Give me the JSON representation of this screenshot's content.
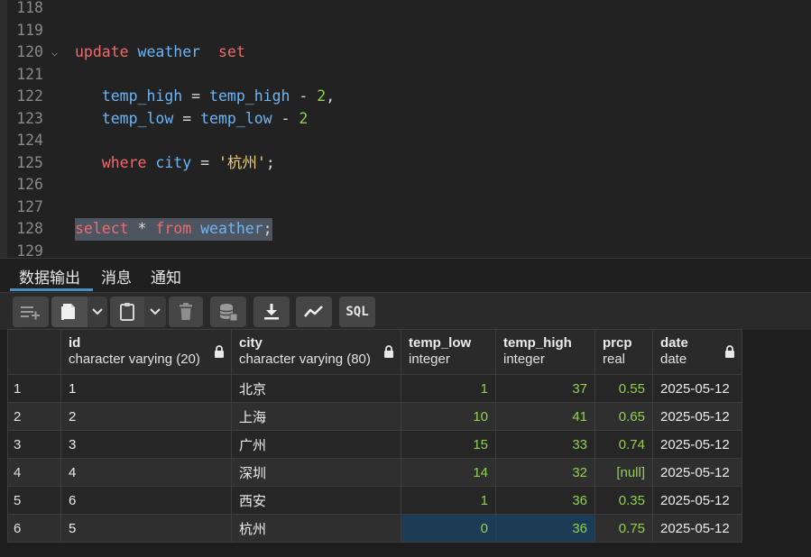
{
  "editor": {
    "lines": [
      {
        "num": "118",
        "tokens": []
      },
      {
        "num": "119",
        "tokens": []
      },
      {
        "num": "120",
        "fold": true,
        "tokens": [
          {
            "t": "update",
            "c": "kw"
          },
          {
            "t": " ",
            "c": "pl"
          },
          {
            "t": "weather",
            "c": "id"
          },
          {
            "t": "  ",
            "c": "pl"
          },
          {
            "t": "set",
            "c": "kw"
          }
        ]
      },
      {
        "num": "121",
        "tokens": []
      },
      {
        "num": "122",
        "tokens": [
          {
            "t": "   ",
            "c": "pl"
          },
          {
            "t": "temp_high",
            "c": "id"
          },
          {
            "t": " = ",
            "c": "op"
          },
          {
            "t": "temp_high",
            "c": "id"
          },
          {
            "t": " - ",
            "c": "op"
          },
          {
            "t": "2",
            "c": "num"
          },
          {
            "t": ",",
            "c": "pl"
          }
        ]
      },
      {
        "num": "123",
        "tokens": [
          {
            "t": "   ",
            "c": "pl"
          },
          {
            "t": "temp_low",
            "c": "id"
          },
          {
            "t": " = ",
            "c": "op"
          },
          {
            "t": "temp_low",
            "c": "id"
          },
          {
            "t": " - ",
            "c": "op"
          },
          {
            "t": "2",
            "c": "num"
          }
        ]
      },
      {
        "num": "124",
        "tokens": []
      },
      {
        "num": "125",
        "tokens": [
          {
            "t": "   ",
            "c": "pl"
          },
          {
            "t": "where",
            "c": "kw"
          },
          {
            "t": " ",
            "c": "pl"
          },
          {
            "t": "city",
            "c": "id"
          },
          {
            "t": " = ",
            "c": "op"
          },
          {
            "t": "'杭州'",
            "c": "str"
          },
          {
            "t": ";",
            "c": "pl"
          }
        ]
      },
      {
        "num": "126",
        "tokens": []
      },
      {
        "num": "127",
        "tokens": []
      },
      {
        "num": "128",
        "selected": true,
        "tokens": [
          {
            "t": "select",
            "c": "kw"
          },
          {
            "t": " * ",
            "c": "op"
          },
          {
            "t": "from",
            "c": "kw"
          },
          {
            "t": " ",
            "c": "pl"
          },
          {
            "t": "weather",
            "c": "id"
          },
          {
            "t": ";",
            "c": "pl"
          }
        ]
      },
      {
        "num": "129",
        "tokens": []
      }
    ]
  },
  "tabs": [
    "数据输出",
    "消息",
    "通知"
  ],
  "toolbar": {
    "icons": [
      "add-row-icon",
      "copy-icon",
      "chevron-down-icon",
      "paste-icon",
      "chevron-down-icon",
      "delete-icon",
      "save-data-icon",
      "download-icon",
      "graph-visualiser-icon",
      "sql-icon"
    ],
    "sql_label": "SQL"
  },
  "grid": {
    "columns": [
      {
        "name": "id",
        "type": "character varying (20)"
      },
      {
        "name": "city",
        "type": "character varying (80)"
      },
      {
        "name": "temp_low",
        "type": "integer"
      },
      {
        "name": "temp_high",
        "type": "integer"
      },
      {
        "name": "prcp",
        "type": "real"
      },
      {
        "name": "date",
        "type": "date"
      }
    ],
    "rows": [
      [
        "1",
        "1",
        "北京",
        "1",
        "37",
        "0.55",
        "2025-05-12"
      ],
      [
        "2",
        "2",
        "上海",
        "10",
        "41",
        "0.65",
        "2025-05-12"
      ],
      [
        "3",
        "3",
        "广州",
        "15",
        "33",
        "0.74",
        "2025-05-12"
      ],
      [
        "4",
        "4",
        "深圳",
        "14",
        "32",
        "[null]",
        "2025-05-12"
      ],
      [
        "5",
        "6",
        "西安",
        "1",
        "36",
        "0.35",
        "2025-05-12"
      ],
      [
        "6",
        "5",
        "杭州",
        "0",
        "36",
        "0.75",
        "2025-05-12"
      ]
    ],
    "highlight_row": 5
  }
}
